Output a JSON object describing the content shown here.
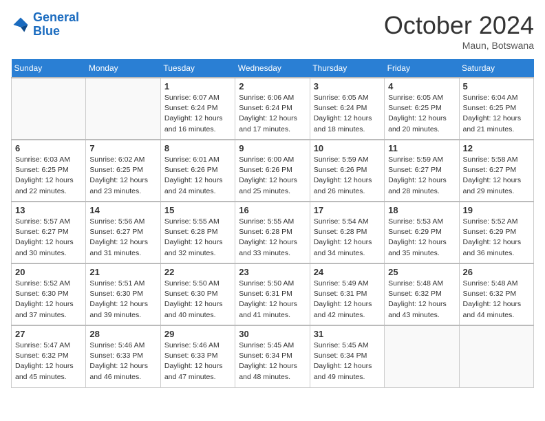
{
  "header": {
    "logo_line1": "General",
    "logo_line2": "Blue",
    "month_title": "October 2024",
    "location": "Maun, Botswana"
  },
  "weekdays": [
    "Sunday",
    "Monday",
    "Tuesday",
    "Wednesday",
    "Thursday",
    "Friday",
    "Saturday"
  ],
  "weeks": [
    [
      {
        "day": "",
        "info": ""
      },
      {
        "day": "",
        "info": ""
      },
      {
        "day": "1",
        "info": "Sunrise: 6:07 AM\nSunset: 6:24 PM\nDaylight: 12 hours and 16 minutes."
      },
      {
        "day": "2",
        "info": "Sunrise: 6:06 AM\nSunset: 6:24 PM\nDaylight: 12 hours and 17 minutes."
      },
      {
        "day": "3",
        "info": "Sunrise: 6:05 AM\nSunset: 6:24 PM\nDaylight: 12 hours and 18 minutes."
      },
      {
        "day": "4",
        "info": "Sunrise: 6:05 AM\nSunset: 6:25 PM\nDaylight: 12 hours and 20 minutes."
      },
      {
        "day": "5",
        "info": "Sunrise: 6:04 AM\nSunset: 6:25 PM\nDaylight: 12 hours and 21 minutes."
      }
    ],
    [
      {
        "day": "6",
        "info": "Sunrise: 6:03 AM\nSunset: 6:25 PM\nDaylight: 12 hours and 22 minutes."
      },
      {
        "day": "7",
        "info": "Sunrise: 6:02 AM\nSunset: 6:25 PM\nDaylight: 12 hours and 23 minutes."
      },
      {
        "day": "8",
        "info": "Sunrise: 6:01 AM\nSunset: 6:26 PM\nDaylight: 12 hours and 24 minutes."
      },
      {
        "day": "9",
        "info": "Sunrise: 6:00 AM\nSunset: 6:26 PM\nDaylight: 12 hours and 25 minutes."
      },
      {
        "day": "10",
        "info": "Sunrise: 5:59 AM\nSunset: 6:26 PM\nDaylight: 12 hours and 26 minutes."
      },
      {
        "day": "11",
        "info": "Sunrise: 5:59 AM\nSunset: 6:27 PM\nDaylight: 12 hours and 28 minutes."
      },
      {
        "day": "12",
        "info": "Sunrise: 5:58 AM\nSunset: 6:27 PM\nDaylight: 12 hours and 29 minutes."
      }
    ],
    [
      {
        "day": "13",
        "info": "Sunrise: 5:57 AM\nSunset: 6:27 PM\nDaylight: 12 hours and 30 minutes."
      },
      {
        "day": "14",
        "info": "Sunrise: 5:56 AM\nSunset: 6:27 PM\nDaylight: 12 hours and 31 minutes."
      },
      {
        "day": "15",
        "info": "Sunrise: 5:55 AM\nSunset: 6:28 PM\nDaylight: 12 hours and 32 minutes."
      },
      {
        "day": "16",
        "info": "Sunrise: 5:55 AM\nSunset: 6:28 PM\nDaylight: 12 hours and 33 minutes."
      },
      {
        "day": "17",
        "info": "Sunrise: 5:54 AM\nSunset: 6:28 PM\nDaylight: 12 hours and 34 minutes."
      },
      {
        "day": "18",
        "info": "Sunrise: 5:53 AM\nSunset: 6:29 PM\nDaylight: 12 hours and 35 minutes."
      },
      {
        "day": "19",
        "info": "Sunrise: 5:52 AM\nSunset: 6:29 PM\nDaylight: 12 hours and 36 minutes."
      }
    ],
    [
      {
        "day": "20",
        "info": "Sunrise: 5:52 AM\nSunset: 6:30 PM\nDaylight: 12 hours and 37 minutes."
      },
      {
        "day": "21",
        "info": "Sunrise: 5:51 AM\nSunset: 6:30 PM\nDaylight: 12 hours and 39 minutes."
      },
      {
        "day": "22",
        "info": "Sunrise: 5:50 AM\nSunset: 6:30 PM\nDaylight: 12 hours and 40 minutes."
      },
      {
        "day": "23",
        "info": "Sunrise: 5:50 AM\nSunset: 6:31 PM\nDaylight: 12 hours and 41 minutes."
      },
      {
        "day": "24",
        "info": "Sunrise: 5:49 AM\nSunset: 6:31 PM\nDaylight: 12 hours and 42 minutes."
      },
      {
        "day": "25",
        "info": "Sunrise: 5:48 AM\nSunset: 6:32 PM\nDaylight: 12 hours and 43 minutes."
      },
      {
        "day": "26",
        "info": "Sunrise: 5:48 AM\nSunset: 6:32 PM\nDaylight: 12 hours and 44 minutes."
      }
    ],
    [
      {
        "day": "27",
        "info": "Sunrise: 5:47 AM\nSunset: 6:32 PM\nDaylight: 12 hours and 45 minutes."
      },
      {
        "day": "28",
        "info": "Sunrise: 5:46 AM\nSunset: 6:33 PM\nDaylight: 12 hours and 46 minutes."
      },
      {
        "day": "29",
        "info": "Sunrise: 5:46 AM\nSunset: 6:33 PM\nDaylight: 12 hours and 47 minutes."
      },
      {
        "day": "30",
        "info": "Sunrise: 5:45 AM\nSunset: 6:34 PM\nDaylight: 12 hours and 48 minutes."
      },
      {
        "day": "31",
        "info": "Sunrise: 5:45 AM\nSunset: 6:34 PM\nDaylight: 12 hours and 49 minutes."
      },
      {
        "day": "",
        "info": ""
      },
      {
        "day": "",
        "info": ""
      }
    ]
  ]
}
